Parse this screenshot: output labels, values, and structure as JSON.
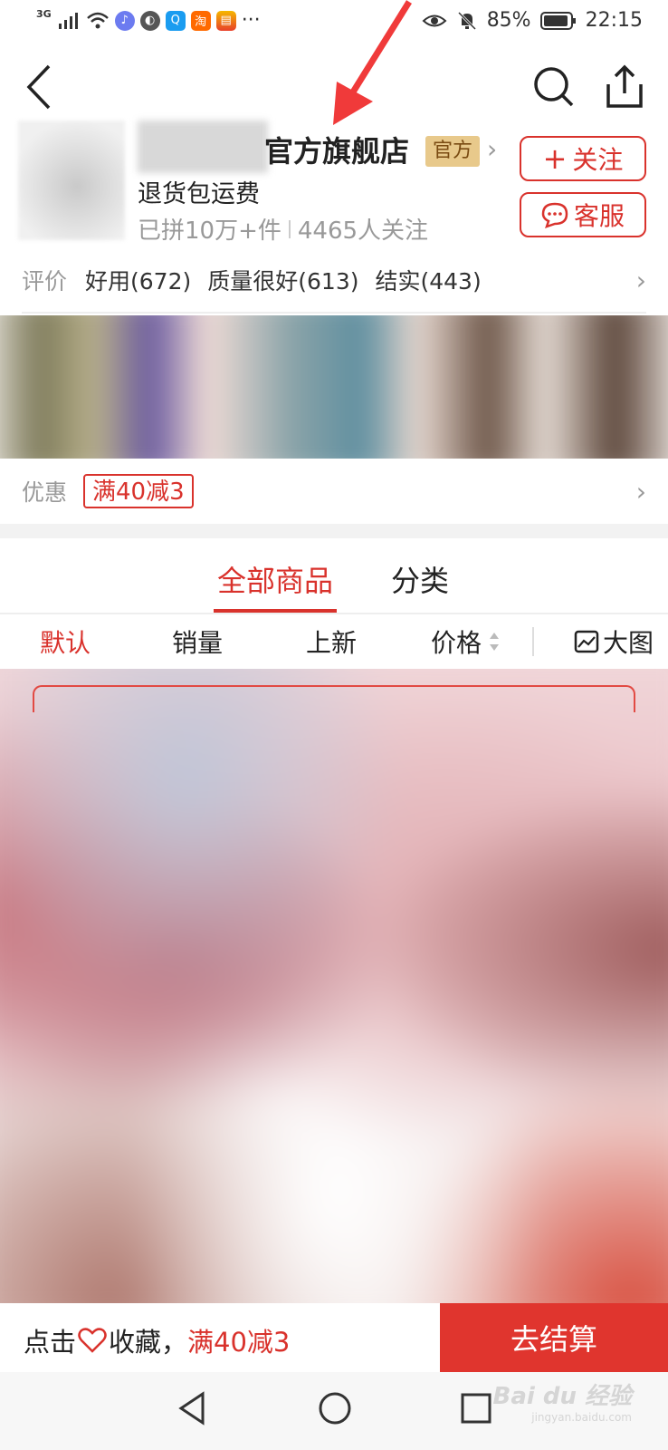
{
  "status_bar": {
    "network": "3G",
    "mini_app_taobao": "淘",
    "more": "···",
    "battery": "85%",
    "time": "22:15"
  },
  "nav": {
    "back_icon": "chevron-left-icon",
    "search_icon": "search-icon",
    "share_icon": "share-icon"
  },
  "store": {
    "name": "官方旗舰店",
    "badge": "官方",
    "return_policy": "退货包运费",
    "sold": "已拼10万+件",
    "followers": "4465人关注",
    "follow_button": "关注",
    "service_button": "客服"
  },
  "reviews": {
    "label": "评价",
    "tags": [
      "好用(672)",
      "质量很好(613)",
      "结实(443)"
    ]
  },
  "promo": {
    "label": "优惠",
    "coupon": "满40减3"
  },
  "tabs": [
    {
      "label": "全部商品",
      "active": true
    },
    {
      "label": "分类",
      "active": false
    }
  ],
  "sort": {
    "default": "默认",
    "sales": "销量",
    "new": "上新",
    "price": "价格",
    "view_mode": "大图"
  },
  "bottom_bar": {
    "tap": "点击",
    "favorite": "收藏，",
    "promo": "满40减3",
    "checkout": "去结算"
  },
  "watermark": {
    "brand": "Bai du 经验",
    "url": "jingyan.baidu.com"
  },
  "colors": {
    "accent": "#d9322c",
    "badge_bg": "#e8c98b"
  }
}
